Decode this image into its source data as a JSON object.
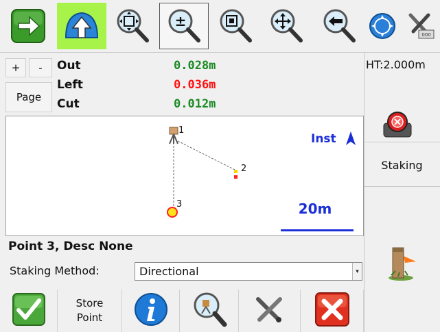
{
  "toolbar": {
    "icons": [
      "next-arrow-icon",
      "upload-arrow-icon",
      "zoom-extents-icon",
      "zoom-in-out-icon",
      "zoom-window-icon",
      "pan-icon",
      "zoom-previous-icon",
      "navigation-globe-icon",
      "tools-icon"
    ]
  },
  "controls": {
    "plus": "+",
    "minus": "-",
    "page": "Page"
  },
  "measurements": {
    "out_label": "Out",
    "out_value": "0.028m",
    "left_label": "Left",
    "left_value": "0.036m",
    "cut_label": "Cut",
    "cut_value": "0.012m",
    "colors": {
      "green": "#1b8a24",
      "red": "#ff1010"
    }
  },
  "map": {
    "point1_label": "1",
    "point2_label": "2",
    "point3_label": "3",
    "mode_label": "Inst",
    "scale_label": "20m",
    "accent": "#1a2fd8"
  },
  "point": {
    "info": "Point 3, Desc None",
    "method_label": "Staking Method:",
    "method_value": "Directional"
  },
  "bottom": {
    "store_line1": "Store",
    "store_line2": "Point",
    "icons": [
      "accept-check-icon",
      "info-icon",
      "search-point-icon",
      "tools-icon",
      "close-x-icon"
    ]
  },
  "right_panel": {
    "ht": "HT:2.000m",
    "staking_label": "Staking",
    "icons": [
      "target-prism-icon",
      "stake-icon"
    ]
  }
}
